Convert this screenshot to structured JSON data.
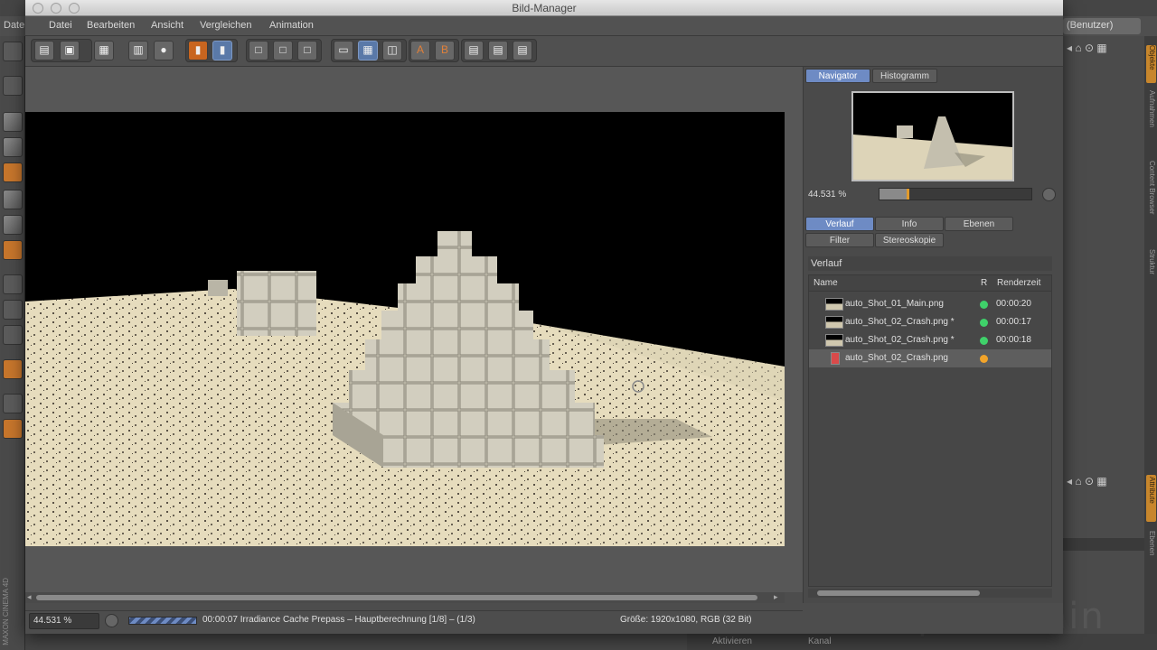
{
  "window": {
    "title": "Bild-Manager"
  },
  "menu": [
    "Datei",
    "Bearbeiten",
    "Ansicht",
    "Vergleichen",
    "Animation"
  ],
  "background_app": {
    "menu_fragment": "Date",
    "layout_dropdown": "(Benutzer)",
    "side_tabs": [
      "Objekte",
      "Aufnahmen",
      "Content Browser",
      "Struktur",
      "Attribute",
      "Ebenen"
    ],
    "bottom_tabs": [
      "Aktivieren",
      "Kanal"
    ],
    "watermark": "pixeltrain",
    "maxon_label": "MAXON CINEMA 4D"
  },
  "navigator": {
    "tabs": [
      "Navigator",
      "Histogramm"
    ],
    "active_tab": "Navigator",
    "zoom": "44.531 %",
    "zoom_fraction": 0.44531
  },
  "panel_tabs": {
    "row1": [
      "Verlauf",
      "Info",
      "Ebenen"
    ],
    "row2": [
      "Filter",
      "Stereoskopie"
    ],
    "active": "Verlauf"
  },
  "history": {
    "title": "Verlauf",
    "columns": {
      "name": "Name",
      "r": "R",
      "time": "Renderzeit"
    },
    "rows": [
      {
        "name": "auto_Shot_01_Main.png",
        "status_color": "#3fd16a",
        "time": "00:00:20",
        "selected": false,
        "rendering": false
      },
      {
        "name": "auto_Shot_02_Crash.png *",
        "status_color": "#3fd16a",
        "time": "00:00:17",
        "selected": false,
        "rendering": false
      },
      {
        "name": "auto_Shot_02_Crash.png *",
        "status_color": "#3fd16a",
        "time": "00:00:18",
        "selected": false,
        "rendering": false
      },
      {
        "name": "auto_Shot_02_Crash.png",
        "status_color": "#f2a42a",
        "time": "",
        "selected": true,
        "rendering": true
      }
    ]
  },
  "statusbar": {
    "zoom": "44.531 %",
    "status": "00:00:07 Irradiance Cache Prepass – Hauptberechnung [1/8] – (1/3)",
    "size": "Größe: 1920x1080, RGB (32 Bit)"
  },
  "colors": {
    "accent": "#6e8bc4",
    "orange": "#c8651f",
    "render_ok": "#3fd16a",
    "render_active": "#f2a42a"
  }
}
